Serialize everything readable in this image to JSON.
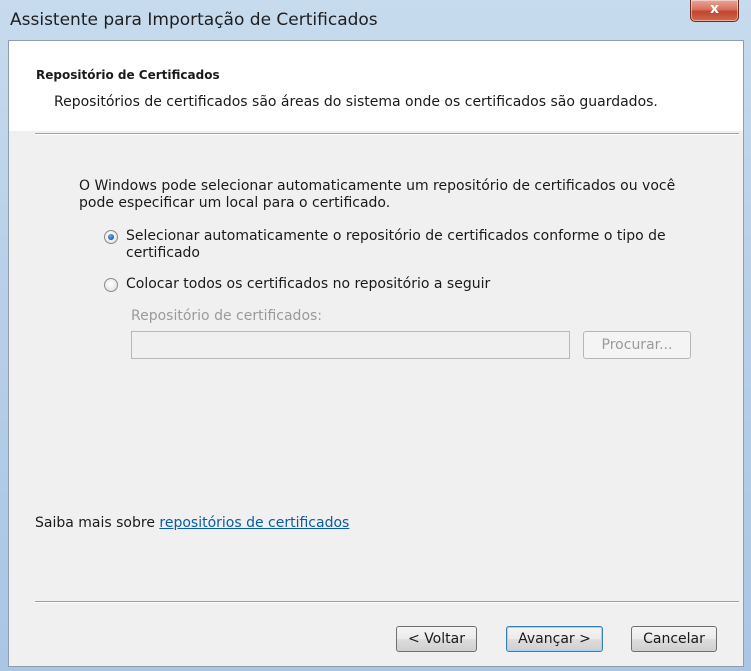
{
  "window": {
    "title": "Assistente para Importação de Certificados",
    "close_glyph": "x"
  },
  "header": {
    "title": "Repositório de Certificados",
    "description": "Repositórios de certificados são áreas do sistema onde os certificados são guardados."
  },
  "body": {
    "intro": "O Windows pode selecionar automaticamente um repositório de certificados ou você pode especificar um local para o certificado.",
    "options": [
      {
        "label": "Selecionar automaticamente o repositório de certificados conforme o tipo de certificado",
        "selected": true
      },
      {
        "label": "Colocar todos os certificados no repositório a seguir",
        "selected": false
      }
    ],
    "store_label": "Repositório de certificados:",
    "store_value": "",
    "browse_label": "Procurar..."
  },
  "footer": {
    "learn_more_prefix": "Saiba mais sobre",
    "learn_more_link": "repositórios de certificados",
    "back_label": "< Voltar",
    "next_label": "Avançar >",
    "cancel_label": "Cancelar"
  },
  "colors": {
    "link": "#0b5ba8",
    "radio_selected": "#1f5fb4",
    "close_button": "#c1442e"
  }
}
